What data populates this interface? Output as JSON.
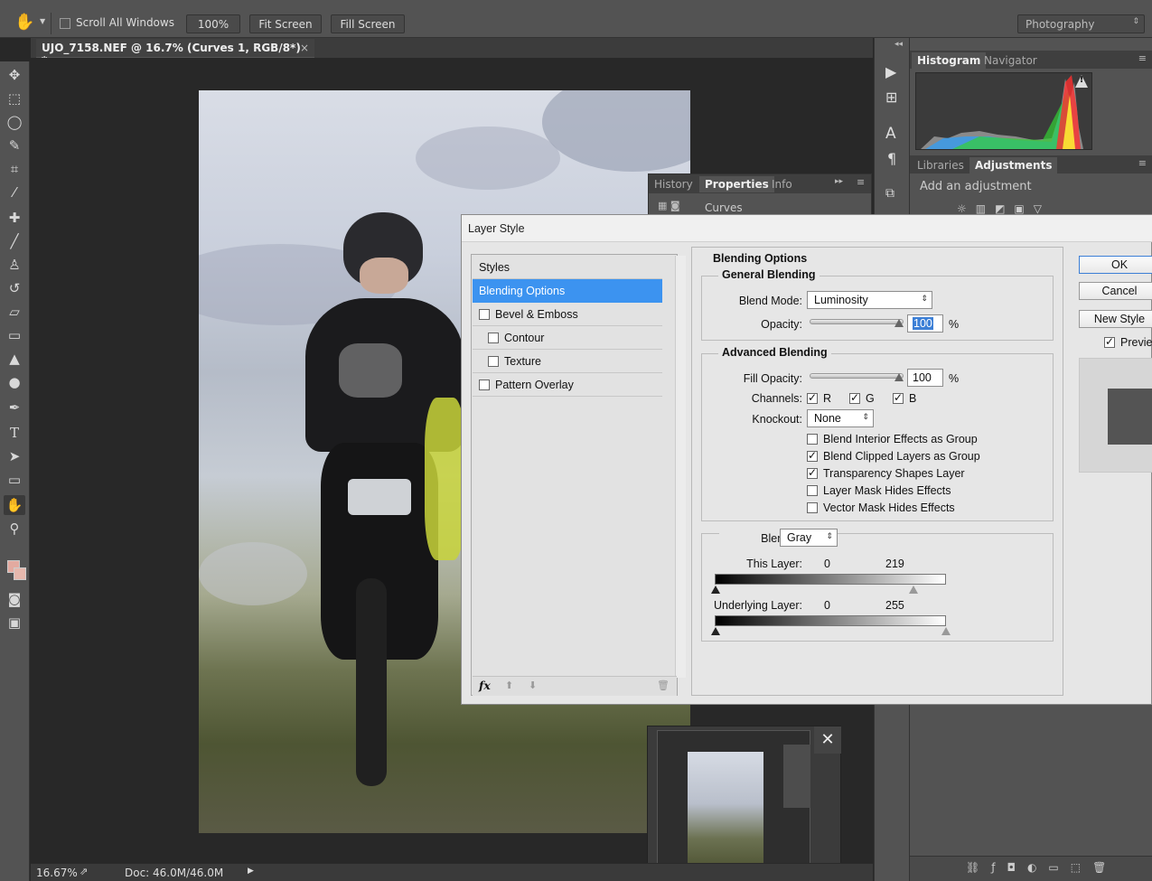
{
  "optbar": {
    "scroll_all_windows": "Scroll All Windows",
    "zoom_100": "100%",
    "fit_screen": "Fit Screen",
    "fill_screen": "Fill Screen",
    "workspace": "Photography"
  },
  "document": {
    "tab_title": "UJO_7158.NEF @ 16.7% (Curves 1, RGB/8*) *",
    "close_glyph": "×"
  },
  "right_panel": {
    "tabs_top": [
      "Histogram",
      "Navigator"
    ],
    "tabs_mid": [
      "Libraries",
      "Adjustments"
    ],
    "add_adjustment": "Add an adjustment"
  },
  "float_panel": {
    "tabs": [
      "History",
      "Properties",
      "Info"
    ],
    "curves_label": "Curves"
  },
  "dialog": {
    "title": "Layer Style",
    "list": [
      {
        "label": "Styles",
        "checkbox": false,
        "indent": false,
        "selected": false
      },
      {
        "label": "Blending Options",
        "checkbox": false,
        "indent": false,
        "selected": true
      },
      {
        "label": "Bevel & Emboss",
        "checkbox": true,
        "indent": false,
        "selected": false
      },
      {
        "label": "Contour",
        "checkbox": true,
        "indent": true,
        "selected": false
      },
      {
        "label": "Texture",
        "checkbox": true,
        "indent": true,
        "selected": false
      },
      {
        "label": "Pattern Overlay",
        "checkbox": true,
        "indent": false,
        "selected": false
      }
    ],
    "fx_label": "fx",
    "section_title": "Blending Options",
    "general": {
      "title": "General Blending",
      "blend_mode_label": "Blend Mode:",
      "blend_mode": "Luminosity",
      "opacity_label": "Opacity:",
      "opacity": "100",
      "percent": "%"
    },
    "advanced": {
      "title": "Advanced Blending",
      "fill_opacity_label": "Fill Opacity:",
      "fill_opacity": "100",
      "percent": "%",
      "channels_label": "Channels:",
      "channel_r": "R",
      "channel_g": "G",
      "channel_b": "B",
      "knockout_label": "Knockout:",
      "knockout": "None",
      "options": [
        {
          "label": "Blend Interior Effects as Group",
          "checked": false
        },
        {
          "label": "Blend Clipped Layers as Group",
          "checked": true
        },
        {
          "label": "Transparency Shapes Layer",
          "checked": true
        },
        {
          "label": "Layer Mask Hides Effects",
          "checked": false
        },
        {
          "label": "Vector Mask Hides Effects",
          "checked": false
        }
      ]
    },
    "blend_if": {
      "label": "Blend If:",
      "channel": "Gray",
      "this_layer_label": "This Layer:",
      "this_layer_low": "0",
      "this_layer_high": "219",
      "underlying_label": "Underlying Layer:",
      "underlying_low": "0",
      "underlying_high": "255"
    },
    "buttons": {
      "ok": "OK",
      "cancel": "Cancel",
      "new_style": "New Style",
      "preview": "Preview"
    }
  },
  "status": {
    "zoom": "16.67%",
    "doc": "Doc: 46.0M/46.0M"
  }
}
